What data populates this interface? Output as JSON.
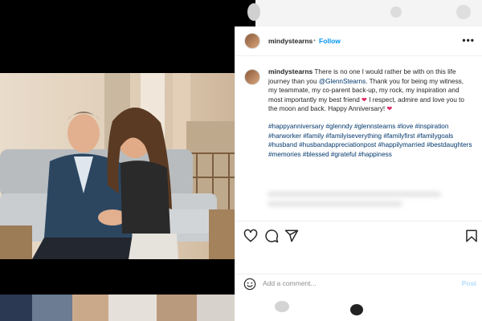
{
  "post": {
    "author": "mindystearns",
    "separator": "•",
    "follow_label": "Follow",
    "more_label": "•••",
    "caption": {
      "author": "mindystearns",
      "text_1": "There is no one I would rather be with on this life journey than you",
      "mention": "@GlennStearns",
      "text_2": ". Thank you for being my witness, my teammate, my co-parent back-up, my rock, my inspiration and most importantly my best friend",
      "heart_1": "❤",
      "text_3": " I respect, admire and love you to the moon and back. Happy Anniversary!",
      "heart_2": "❤",
      "hashtags": "#happyanniversary #glenndy #glennstearns #love #inspiration #harworker #family #familyiseverything #familyfirst #familygoals #husband #husbandappreciationpost #happilymarried #bestdaughters #memories #blessed #grateful #happiness"
    }
  },
  "actions": {
    "like_icon": "heart-icon",
    "comment_icon": "comment-icon",
    "share_icon": "share-icon",
    "save_icon": "bookmark-icon"
  },
  "comment_box": {
    "placeholder": "Add a comment...",
    "post_label": "Post"
  },
  "colors": {
    "link": "#00376b",
    "follow": "#0095f6",
    "post_disabled": "#b2dffc"
  }
}
